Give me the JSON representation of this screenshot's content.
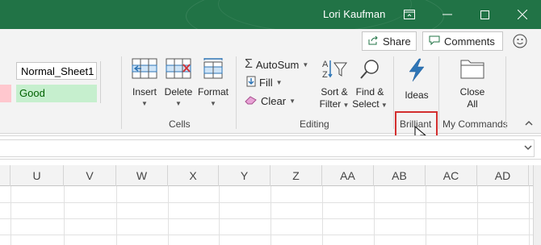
{
  "titlebar": {
    "user_name": "Lori Kaufman",
    "accent": "#217346"
  },
  "top_actions": {
    "share_label": "Share",
    "comments_label": "Comments"
  },
  "styles": {
    "normal_label": "Normal_Sheet1",
    "good_label": "Good"
  },
  "cells_group": {
    "insert_label": "Insert",
    "delete_label": "Delete",
    "format_label": "Format",
    "group_label": "Cells"
  },
  "editing_group": {
    "autosum_label": "AutoSum",
    "fill_label": "Fill",
    "clear_label": "Clear",
    "sort_filter_line1": "Sort &",
    "sort_filter_line2": "Filter",
    "find_select_line1": "Find &",
    "find_select_line2": "Select",
    "group_label": "Editing"
  },
  "brilliant_group": {
    "ideas_label": "Ideas",
    "group_label": "Brilliant"
  },
  "my_commands_group": {
    "close_all_line1": "Close",
    "close_all_line2": "All",
    "group_label": "My Commands"
  },
  "grid": {
    "columns": [
      "U",
      "V",
      "W",
      "X",
      "Y",
      "Z",
      "AA",
      "AB",
      "AC",
      "AD"
    ]
  }
}
